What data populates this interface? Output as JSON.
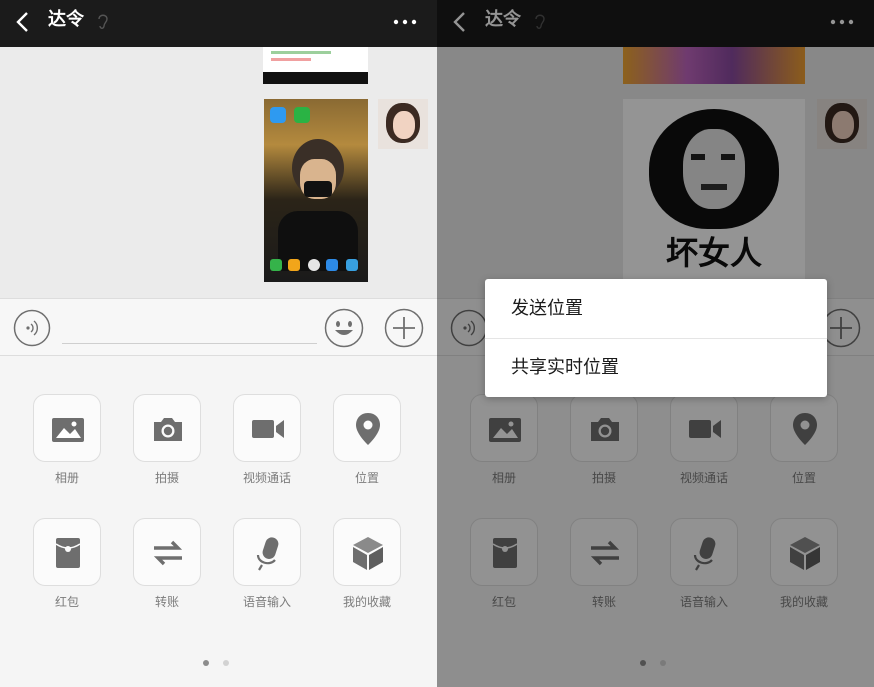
{
  "chat": {
    "title": "达令",
    "meme_caption": "坏女人"
  },
  "tools": [
    {
      "label": "相册",
      "icon": "album-icon"
    },
    {
      "label": "拍摄",
      "icon": "camera-icon"
    },
    {
      "label": "视频通话",
      "icon": "video-call-icon"
    },
    {
      "label": "位置",
      "icon": "location-icon"
    },
    {
      "label": "红包",
      "icon": "red-packet-icon"
    },
    {
      "label": "转账",
      "icon": "transfer-icon"
    },
    {
      "label": "语音输入",
      "icon": "microphone-icon"
    },
    {
      "label": "我的收藏",
      "icon": "favorites-icon"
    }
  ],
  "location_menu": {
    "send_location": "发送位置",
    "share_live_location": "共享实时位置"
  },
  "page_indicator": {
    "total": 2,
    "active": 1
  },
  "colors": {
    "titlebar": "#1b1b1b",
    "tool_icon": "#6e6e6e",
    "overlay": "rgba(0,0,0,0.42)"
  }
}
